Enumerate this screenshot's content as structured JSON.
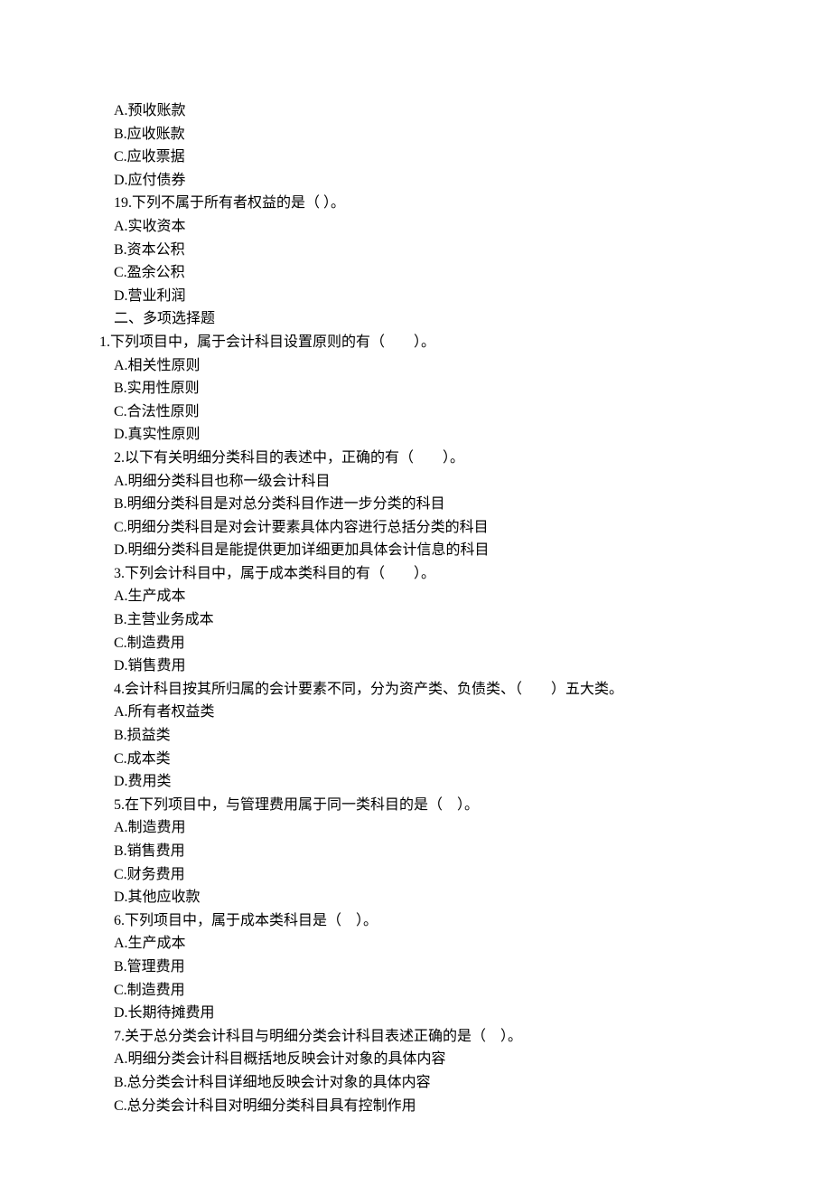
{
  "lines": [
    {
      "text": "A.预收账款",
      "indent": true
    },
    {
      "text": "B.应收账款",
      "indent": true
    },
    {
      "text": "C.应收票据",
      "indent": true
    },
    {
      "text": "D.应付债券",
      "indent": true
    },
    {
      "text": "19.下列不属于所有者权益的是（ ）。",
      "indent": true
    },
    {
      "text": "A.实收资本",
      "indent": true
    },
    {
      "text": "B.资本公积",
      "indent": true
    },
    {
      "text": "C.盈余公积",
      "indent": true
    },
    {
      "text": "D.营业利润",
      "indent": true
    },
    {
      "text": "二、多项选择题",
      "indent": true
    },
    {
      "text": "1.下列项目中，属于会计科目设置原则的有（　　）。",
      "indent": false
    },
    {
      "text": "A.相关性原则",
      "indent": true
    },
    {
      "text": "B.实用性原则",
      "indent": true
    },
    {
      "text": "C.合法性原则",
      "indent": true
    },
    {
      "text": "D.真实性原则",
      "indent": true
    },
    {
      "text": "2.以下有关明细分类科目的表述中，正确的有（　　）。",
      "indent": true
    },
    {
      "text": "A.明细分类科目也称一级会计科目",
      "indent": true
    },
    {
      "text": "B.明细分类科目是对总分类科目作进一步分类的科目",
      "indent": true
    },
    {
      "text": "C.明细分类科目是对会计要素具体内容进行总括分类的科目",
      "indent": true
    },
    {
      "text": "D.明细分类科目是能提供更加详细更加具体会计信息的科目",
      "indent": true
    },
    {
      "text": "3.下列会计科目中，属于成本类科目的有（　　）。",
      "indent": true
    },
    {
      "text": "A.生产成本",
      "indent": true
    },
    {
      "text": "B.主营业务成本",
      "indent": true
    },
    {
      "text": "C.制造费用",
      "indent": true
    },
    {
      "text": "D.销售费用",
      "indent": true
    },
    {
      "text": "4.会计科目按其所归属的会计要素不同，分为资产类、负债类、（　　）五大类。",
      "indent": true
    },
    {
      "text": "A.所有者权益类",
      "indent": true
    },
    {
      "text": "B.损益类",
      "indent": true
    },
    {
      "text": "C.成本类",
      "indent": true
    },
    {
      "text": "D.费用类",
      "indent": true
    },
    {
      "text": "5.在下列项目中，与管理费用属于同一类科目的是（　）。",
      "indent": true
    },
    {
      "text": "A.制造费用",
      "indent": true
    },
    {
      "text": "B.销售费用",
      "indent": true
    },
    {
      "text": "C.财务费用",
      "indent": true
    },
    {
      "text": "D.其他应收款",
      "indent": true
    },
    {
      "text": "6.下列项目中，属于成本类科目是（　）。",
      "indent": true
    },
    {
      "text": "A.生产成本",
      "indent": true
    },
    {
      "text": "B.管理费用",
      "indent": true
    },
    {
      "text": "C.制造费用",
      "indent": true
    },
    {
      "text": "D.长期待摊费用",
      "indent": true
    },
    {
      "text": "7.关于总分类会计科目与明细分类会计科目表述正确的是（　）。",
      "indent": true
    },
    {
      "text": "A.明细分类会计科目概括地反映会计对象的具体内容",
      "indent": true
    },
    {
      "text": "B.总分类会计科目详细地反映会计对象的具体内容",
      "indent": true
    },
    {
      "text": "C.总分类会计科目对明细分类科目具有控制作用",
      "indent": true
    }
  ]
}
